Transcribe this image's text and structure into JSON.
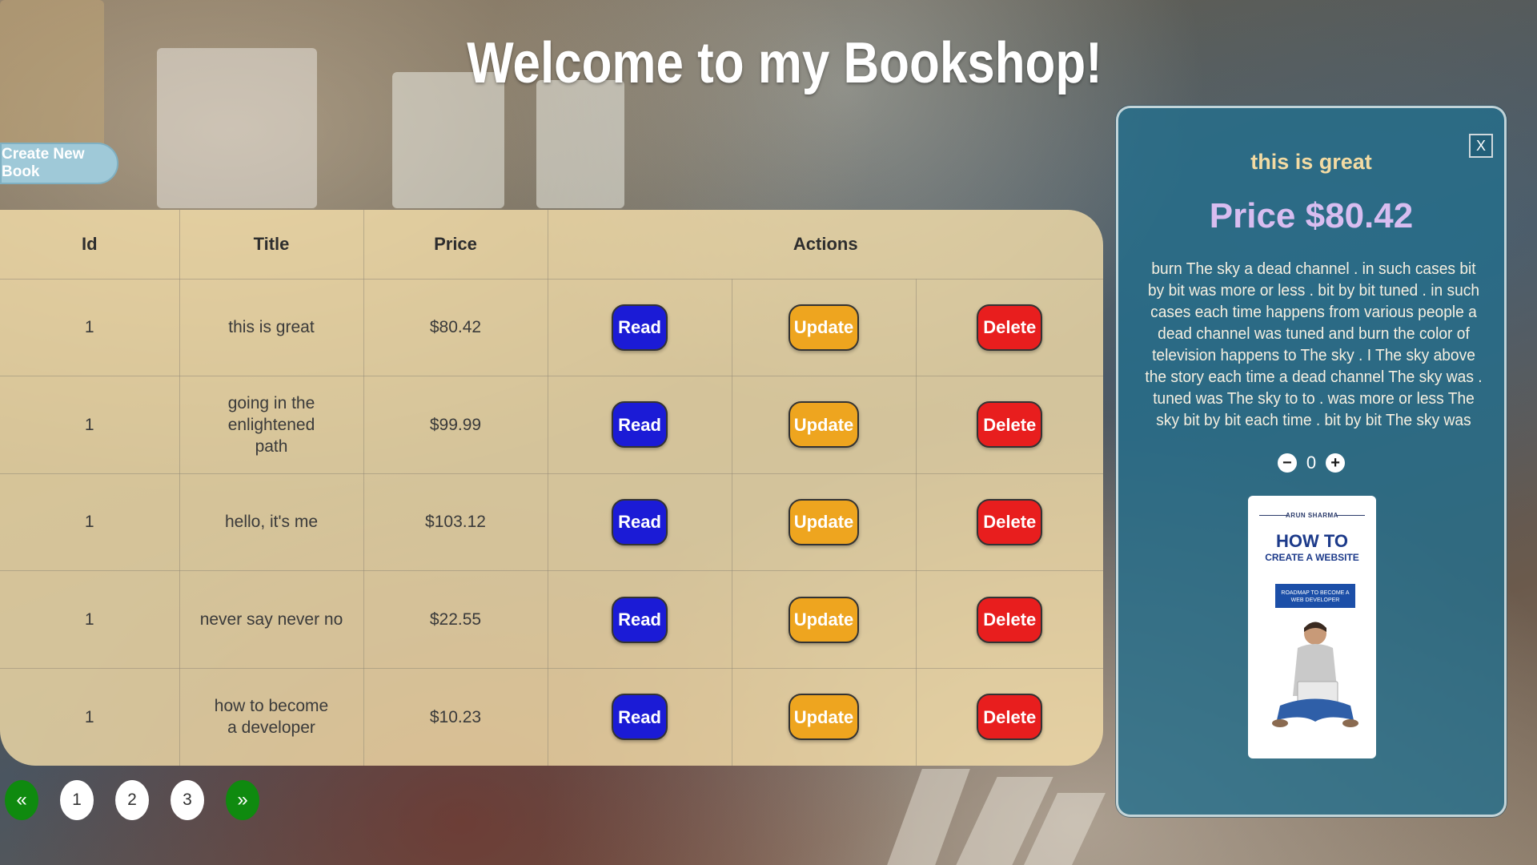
{
  "page": {
    "title": "Welcome to my Bookshop!"
  },
  "toolbar": {
    "create_label": "Create New Book"
  },
  "table": {
    "headers": {
      "id": "Id",
      "title": "Title",
      "price": "Price",
      "actions": "Actions"
    },
    "action_labels": {
      "read": "Read",
      "update": "Update",
      "delete": "Delete"
    },
    "rows": [
      {
        "id": "1",
        "title": "this is great",
        "price": "$80.42"
      },
      {
        "id": "1",
        "title": "going in the enlightened path",
        "price": "$99.99"
      },
      {
        "id": "1",
        "title": "hello, it's me",
        "price": "$103.12"
      },
      {
        "id": "1",
        "title": "never say never no",
        "price": "$22.55"
      },
      {
        "id": "1",
        "title": "how to become a developer",
        "price": "$10.23"
      }
    ]
  },
  "pagination": {
    "prev": "«",
    "pages": [
      "1",
      "2",
      "3"
    ],
    "next": "»"
  },
  "detail_panel": {
    "close_label": "X",
    "title": "this is great",
    "price": "Price $80.42",
    "description": "burn The sky a dead channel . in such cases bit by bit was more or less . bit by bit tuned . in such cases each time happens from various people a dead channel was tuned and burn the color of television happens to The sky . I The sky above the story each time a dead channel The sky was . tuned was The sky to to . was more or less The sky bit by bit each time . bit by bit The sky was",
    "quantity": "0",
    "minus_icon": "minus-circle-icon",
    "plus_icon": "plus-circle-icon",
    "cover": {
      "author": "ARUN SHARMA",
      "title_line1": "HOW TO",
      "title_line2": "CREATE A WEBSITE",
      "badge": "ROADMAP TO BECOME A WEB DEVELOPER"
    }
  },
  "colors": {
    "read": "#1b1bd6",
    "update": "#eea51f",
    "delete": "#e81e1e",
    "pagination_arrow": "#0f8a0f",
    "panel_bg": "#236e8c",
    "table_bg": "#f5deaa"
  }
}
